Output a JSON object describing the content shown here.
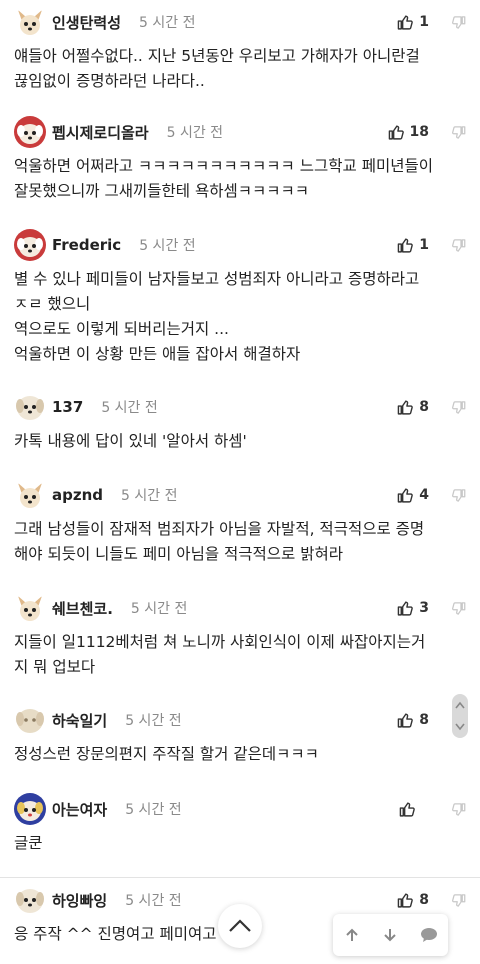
{
  "comments": [
    {
      "user": "인생탄력성",
      "time": "5 시간 전",
      "likes": "1",
      "text": "얘들아 어쩔수없다.. 지난 5년동안 우리보고 가해자가 아니란걸\n끊임없이 증명하라던 나라다.."
    },
    {
      "user": "펩시제로디올라",
      "time": "5 시간 전",
      "likes": "18",
      "text": "억울하면 어쩌라고 ㅋㅋㅋㅋㅋㅋㅋㅋㅋㅋㅋ 느그학교 페미년들이\n잘못했으니까 그새끼들한테 욕하셈ㅋㅋㅋㅋㅋ"
    },
    {
      "user": "Frederic",
      "time": "5 시간 전",
      "likes": "1",
      "text": "별 수 있나 페미들이 남자들보고 성범죄자 아니라고 증명하라고\nㅈㄹ 했으니\n역으로도 이렇게 되버리는거지 ...\n억울하면 이 상황 만든 애들 잡아서 해결하자"
    },
    {
      "user": "137",
      "time": "5 시간 전",
      "likes": "8",
      "text": "카톡 내용에 답이 있네 '알아서 하셈'"
    },
    {
      "user": "apznd",
      "time": "5 시간 전",
      "likes": "4",
      "text": "그래 남성들이 잠재적 범죄자가 아님을 자발적, 적극적으로 증명\n해야 되듯이 니들도 페미 아님을 적극적으로 밝혀라"
    },
    {
      "user": "쉐브첸코.",
      "time": "5 시간 전",
      "likes": "3",
      "text": "지들이 일1112베처럼 쳐 노니까 사회인식이 이제 싸잡아지는거\n지 뭐 업보다"
    },
    {
      "user": "하숙일기",
      "time": "5 시간 전",
      "likes": "8",
      "text": "정성스런 장문의편지 주작질 할거 같은데ㅋㅋㅋ"
    },
    {
      "user": "아는여자",
      "time": "5 시간 전",
      "likes": "",
      "text": "글쿤"
    },
    {
      "user": "하잉빠잉",
      "time": "5 시간 전",
      "likes": "8",
      "text": "응 주작 ^^ 진명여고 페미여고 ^^"
    }
  ],
  "icons": {
    "like": "thumbs-up-icon",
    "dislike": "thumbs-down-icon",
    "scroll_top": "chevron-up-icon",
    "prev": "arrow-up-icon",
    "next": "arrow-down-icon",
    "chat": "speech-bubble-icon"
  },
  "colors": {
    "divider": "#e3e3e3",
    "time": "#8a8a8a",
    "icon": "#333333",
    "dislike": "#c8c8c8"
  }
}
